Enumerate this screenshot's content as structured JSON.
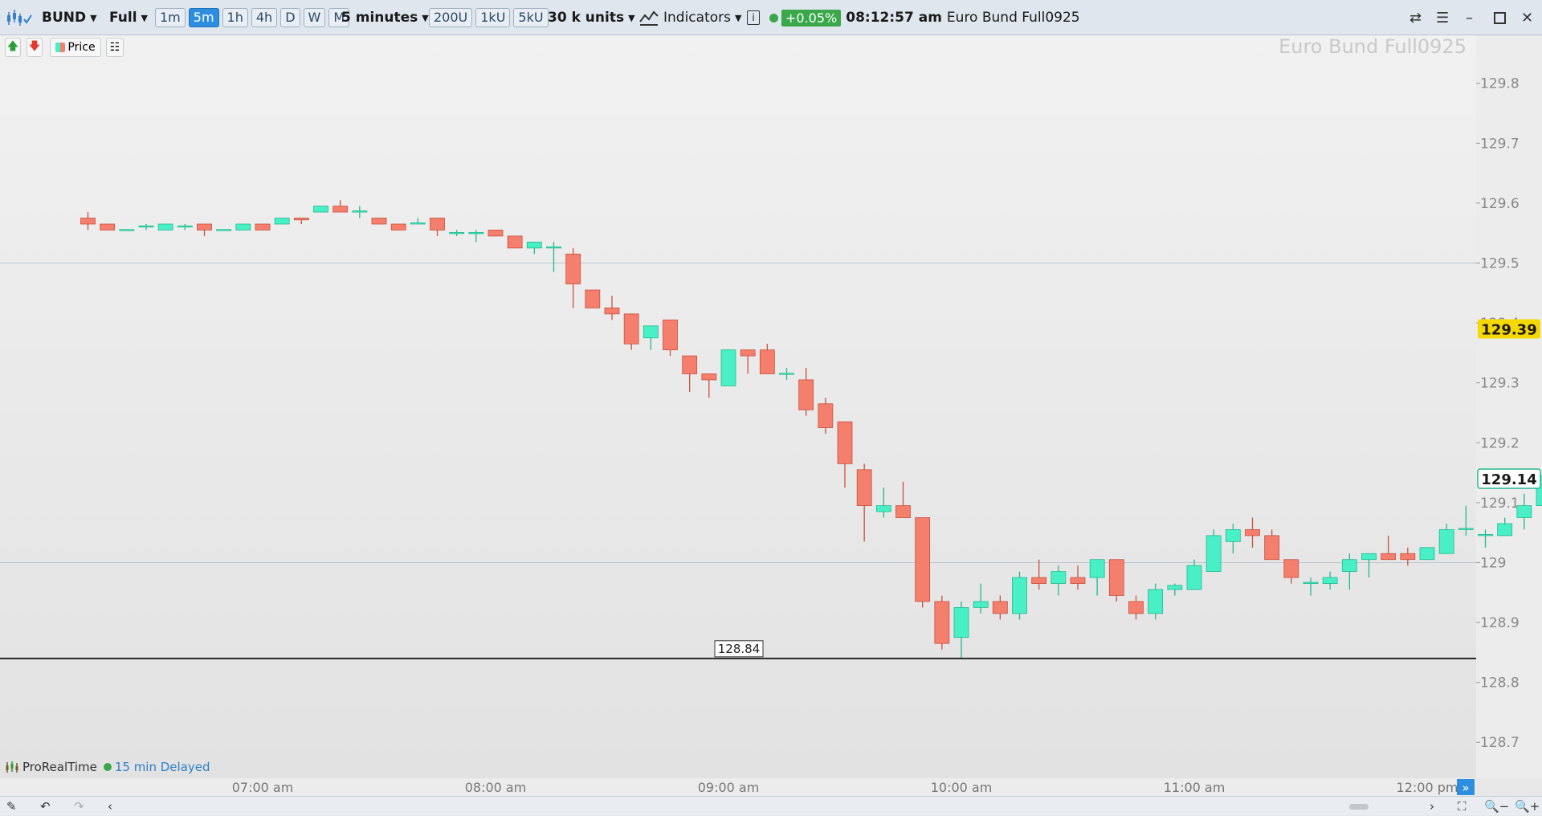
{
  "toolbar": {
    "symbol": "BUND",
    "mode": "Full",
    "timeframes": [
      {
        "label": "1m",
        "active": false
      },
      {
        "label": "5m",
        "active": true
      },
      {
        "label": "1h",
        "active": false
      },
      {
        "label": "4h",
        "active": false
      },
      {
        "label": "D",
        "active": false
      },
      {
        "label": "W",
        "active": false
      },
      {
        "label": "M",
        "active": false
      }
    ],
    "interval": "5 minutes",
    "unit_buttons": [
      "200U",
      "1kU",
      "5kU"
    ],
    "units": "30 k units",
    "indicators": "Indicators",
    "info_icon": "i",
    "change": "+0.05%",
    "time": "08:12:57 am",
    "instrument": "Euro Bund Full0925"
  },
  "chart_tools": {
    "price_label": "Price"
  },
  "watermark": "Euro Bund Full0925",
  "footer": {
    "brand": "ProRealTime",
    "status": "15 min Delayed"
  },
  "colors": {
    "up": "#49efc5",
    "down": "#f47f6c",
    "up_wick": "#22b98f",
    "down_wick": "#c9503e",
    "price_badge": "#f5d800",
    "accent": "#2d8ee0"
  },
  "chart_data": {
    "type": "candlestick",
    "instrument": "Euro Bund Full0925",
    "interval": "5 minutes",
    "ylim": [
      128.64,
      129.88
    ],
    "y_ticks": [
      "129.8",
      "129.7",
      "129.6",
      "129.5",
      "129.4",
      "129.3",
      "129.2",
      "129.1",
      "129",
      "128.9",
      "128.8",
      "128.7"
    ],
    "x_ticks": [
      "07:00 am",
      "08:00 am",
      "09:00 am",
      "10:00 am",
      "11:00 am",
      "12:00 pm"
    ],
    "current_price": "129.14",
    "marker_price": "129.39",
    "support_line": "128.84",
    "reference_lines": [
      129.5,
      129.0
    ],
    "candles": [
      {
        "t": "06:15",
        "o": 129.575,
        "h": 129.585,
        "l": 129.555,
        "c": 129.565
      },
      {
        "t": "06:20",
        "o": 129.565,
        "h": 129.565,
        "l": 129.555,
        "c": 129.555
      },
      {
        "t": "06:25",
        "o": 129.555,
        "h": 129.555,
        "l": 129.555,
        "c": 129.555
      },
      {
        "t": "06:30",
        "o": 129.56,
        "h": 129.565,
        "l": 129.555,
        "c": 129.562
      },
      {
        "t": "06:35",
        "o": 129.555,
        "h": 129.565,
        "l": 129.555,
        "c": 129.565
      },
      {
        "t": "06:40",
        "o": 129.56,
        "h": 129.565,
        "l": 129.555,
        "c": 129.562
      },
      {
        "t": "06:45",
        "o": 129.565,
        "h": 129.565,
        "l": 129.545,
        "c": 129.555
      },
      {
        "t": "06:50",
        "o": 129.555,
        "h": 129.555,
        "l": 129.555,
        "c": 129.555
      },
      {
        "t": "06:55",
        "o": 129.555,
        "h": 129.565,
        "l": 129.555,
        "c": 129.565
      },
      {
        "t": "07:00",
        "o": 129.565,
        "h": 129.565,
        "l": 129.555,
        "c": 129.555
      },
      {
        "t": "07:05",
        "o": 129.565,
        "h": 129.575,
        "l": 129.565,
        "c": 129.575
      },
      {
        "t": "07:10",
        "o": 129.575,
        "h": 129.575,
        "l": 129.565,
        "c": 129.572
      },
      {
        "t": "07:15",
        "o": 129.585,
        "h": 129.595,
        "l": 129.585,
        "c": 129.595
      },
      {
        "t": "07:20",
        "o": 129.595,
        "h": 129.605,
        "l": 129.585,
        "c": 129.585
      },
      {
        "t": "07:25",
        "o": 129.585,
        "h": 129.595,
        "l": 129.575,
        "c": 129.587
      },
      {
        "t": "07:30",
        "o": 129.575,
        "h": 129.575,
        "l": 129.565,
        "c": 129.565
      },
      {
        "t": "07:35",
        "o": 129.565,
        "h": 129.565,
        "l": 129.555,
        "c": 129.555
      },
      {
        "t": "07:40",
        "o": 129.565,
        "h": 129.575,
        "l": 129.565,
        "c": 129.567
      },
      {
        "t": "07:45",
        "o": 129.575,
        "h": 129.575,
        "l": 129.545,
        "c": 129.555
      },
      {
        "t": "07:50",
        "o": 129.55,
        "h": 129.555,
        "l": 129.545,
        "c": 129.55
      },
      {
        "t": "07:55",
        "o": 129.55,
        "h": 129.555,
        "l": 129.535,
        "c": 129.55
      },
      {
        "t": "08:00",
        "o": 129.555,
        "h": 129.555,
        "l": 129.545,
        "c": 129.545
      },
      {
        "t": "08:05",
        "o": 129.545,
        "h": 129.545,
        "l": 129.525,
        "c": 129.525
      },
      {
        "t": "08:10",
        "o": 129.525,
        "h": 129.535,
        "l": 129.515,
        "c": 129.535
      },
      {
        "t": "08:15",
        "o": 129.525,
        "h": 129.535,
        "l": 129.485,
        "c": 129.527
      },
      {
        "t": "08:20",
        "o": 129.515,
        "h": 129.525,
        "l": 129.425,
        "c": 129.465
      },
      {
        "t": "08:25",
        "o": 129.455,
        "h": 129.455,
        "l": 129.425,
        "c": 129.425
      },
      {
        "t": "08:30",
        "o": 129.425,
        "h": 129.445,
        "l": 129.405,
        "c": 129.415
      },
      {
        "t": "08:35",
        "o": 129.415,
        "h": 129.415,
        "l": 129.355,
        "c": 129.365
      },
      {
        "t": "08:40",
        "o": 129.375,
        "h": 129.395,
        "l": 129.355,
        "c": 129.395
      },
      {
        "t": "08:45",
        "o": 129.405,
        "h": 129.405,
        "l": 129.345,
        "c": 129.355
      },
      {
        "t": "08:50",
        "o": 129.345,
        "h": 129.345,
        "l": 129.285,
        "c": 129.315
      },
      {
        "t": "08:55",
        "o": 129.315,
        "h": 129.315,
        "l": 129.275,
        "c": 129.305
      },
      {
        "t": "09:00",
        "o": 129.295,
        "h": 129.355,
        "l": 129.295,
        "c": 129.355
      },
      {
        "t": "09:05",
        "o": 129.355,
        "h": 129.355,
        "l": 129.315,
        "c": 129.345
      },
      {
        "t": "09:10",
        "o": 129.355,
        "h": 129.365,
        "l": 129.315,
        "c": 129.315
      },
      {
        "t": "09:15",
        "o": 129.315,
        "h": 129.325,
        "l": 129.305,
        "c": 129.315
      },
      {
        "t": "09:20",
        "o": 129.305,
        "h": 129.325,
        "l": 129.245,
        "c": 129.255
      },
      {
        "t": "09:25",
        "o": 129.265,
        "h": 129.275,
        "l": 129.215,
        "c": 129.225
      },
      {
        "t": "09:30",
        "o": 129.235,
        "h": 129.235,
        "l": 129.125,
        "c": 129.165
      },
      {
        "t": "09:35",
        "o": 129.155,
        "h": 129.165,
        "l": 129.035,
        "c": 129.095
      },
      {
        "t": "09:40",
        "o": 129.085,
        "h": 129.125,
        "l": 129.075,
        "c": 129.095
      },
      {
        "t": "09:45",
        "o": 129.095,
        "h": 129.135,
        "l": 129.075,
        "c": 129.075
      },
      {
        "t": "09:50",
        "o": 129.075,
        "h": 129.075,
        "l": 128.925,
        "c": 128.935
      },
      {
        "t": "09:55",
        "o": 128.935,
        "h": 128.945,
        "l": 128.855,
        "c": 128.865
      },
      {
        "t": "10:00",
        "o": 128.875,
        "h": 128.935,
        "l": 128.84,
        "c": 128.925
      },
      {
        "t": "10:05",
        "o": 128.925,
        "h": 128.965,
        "l": 128.915,
        "c": 128.935
      },
      {
        "t": "10:10",
        "o": 128.935,
        "h": 128.945,
        "l": 128.905,
        "c": 128.915
      },
      {
        "t": "10:15",
        "o": 128.915,
        "h": 128.985,
        "l": 128.905,
        "c": 128.975
      },
      {
        "t": "10:20",
        "o": 128.975,
        "h": 129.005,
        "l": 128.955,
        "c": 128.965
      },
      {
        "t": "10:25",
        "o": 128.965,
        "h": 128.995,
        "l": 128.945,
        "c": 128.985
      },
      {
        "t": "10:30",
        "o": 128.975,
        "h": 128.995,
        "l": 128.955,
        "c": 128.965
      },
      {
        "t": "10:35",
        "o": 128.975,
        "h": 129.005,
        "l": 128.945,
        "c": 129.005
      },
      {
        "t": "10:40",
        "o": 129.005,
        "h": 129.005,
        "l": 128.935,
        "c": 128.945
      },
      {
        "t": "10:45",
        "o": 128.935,
        "h": 128.945,
        "l": 128.905,
        "c": 128.915
      },
      {
        "t": "10:50",
        "o": 128.915,
        "h": 128.965,
        "l": 128.905,
        "c": 128.955
      },
      {
        "t": "10:55",
        "o": 128.955,
        "h": 128.965,
        "l": 128.945,
        "c": 128.962
      },
      {
        "t": "11:00",
        "o": 128.955,
        "h": 129.005,
        "l": 128.955,
        "c": 128.995
      },
      {
        "t": "11:05",
        "o": 128.985,
        "h": 129.055,
        "l": 128.985,
        "c": 129.045
      },
      {
        "t": "11:10",
        "o": 129.035,
        "h": 129.065,
        "l": 129.015,
        "c": 129.055
      },
      {
        "t": "11:15",
        "o": 129.055,
        "h": 129.075,
        "l": 129.025,
        "c": 129.045
      },
      {
        "t": "11:20",
        "o": 129.045,
        "h": 129.055,
        "l": 129.005,
        "c": 129.005
      },
      {
        "t": "11:25",
        "o": 129.005,
        "h": 129.005,
        "l": 128.965,
        "c": 128.975
      },
      {
        "t": "11:30",
        "o": 128.965,
        "h": 128.975,
        "l": 128.945,
        "c": 128.967
      },
      {
        "t": "11:35",
        "o": 128.965,
        "h": 128.985,
        "l": 128.955,
        "c": 128.975
      },
      {
        "t": "11:40",
        "o": 128.985,
        "h": 129.015,
        "l": 128.955,
        "c": 129.005
      },
      {
        "t": "11:45",
        "o": 129.005,
        "h": 129.015,
        "l": 128.975,
        "c": 129.015
      },
      {
        "t": "11:50",
        "o": 129.015,
        "h": 129.045,
        "l": 129.005,
        "c": 129.005
      },
      {
        "t": "11:55",
        "o": 129.015,
        "h": 129.025,
        "l": 128.995,
        "c": 129.005
      },
      {
        "t": "12:00",
        "o": 129.005,
        "h": 129.025,
        "l": 129.005,
        "c": 129.025
      },
      {
        "t": "12:05",
        "o": 129.015,
        "h": 129.065,
        "l": 129.015,
        "c": 129.055
      },
      {
        "t": "12:10",
        "o": 129.055,
        "h": 129.095,
        "l": 129.045,
        "c": 129.057
      },
      {
        "t": "12:15",
        "o": 129.045,
        "h": 129.055,
        "l": 129.025,
        "c": 129.047
      },
      {
        "t": "12:20",
        "o": 129.045,
        "h": 129.075,
        "l": 129.045,
        "c": 129.065
      },
      {
        "t": "12:25",
        "o": 129.075,
        "h": 129.115,
        "l": 129.055,
        "c": 129.095
      },
      {
        "t": "12:30",
        "o": 129.095,
        "h": 129.155,
        "l": 129.095,
        "c": 129.145
      }
    ]
  }
}
